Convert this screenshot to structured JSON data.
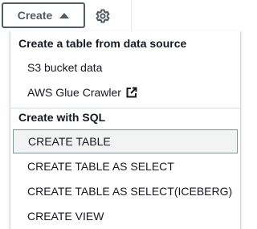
{
  "toolbar": {
    "create_label": "Create"
  },
  "menu": {
    "group1_title": "Create a table from data source",
    "s3_label": "S3 bucket data",
    "glue_label": "AWS Glue Crawler",
    "group2_title": "Create with SQL",
    "items": [
      "CREATE TABLE",
      "CREATE TABLE AS SELECT",
      "CREATE TABLE AS SELECT(ICEBERG)",
      "CREATE VIEW"
    ]
  },
  "icons": {
    "caret": "caret-up-icon",
    "settings": "gear-icon",
    "external": "external-link-icon"
  },
  "colors": {
    "text": "#16191f",
    "button_border": "#545b64",
    "highlight_bg": "#f2f3f3",
    "highlight_border": "#879596",
    "divider": "#d5dbdb"
  }
}
